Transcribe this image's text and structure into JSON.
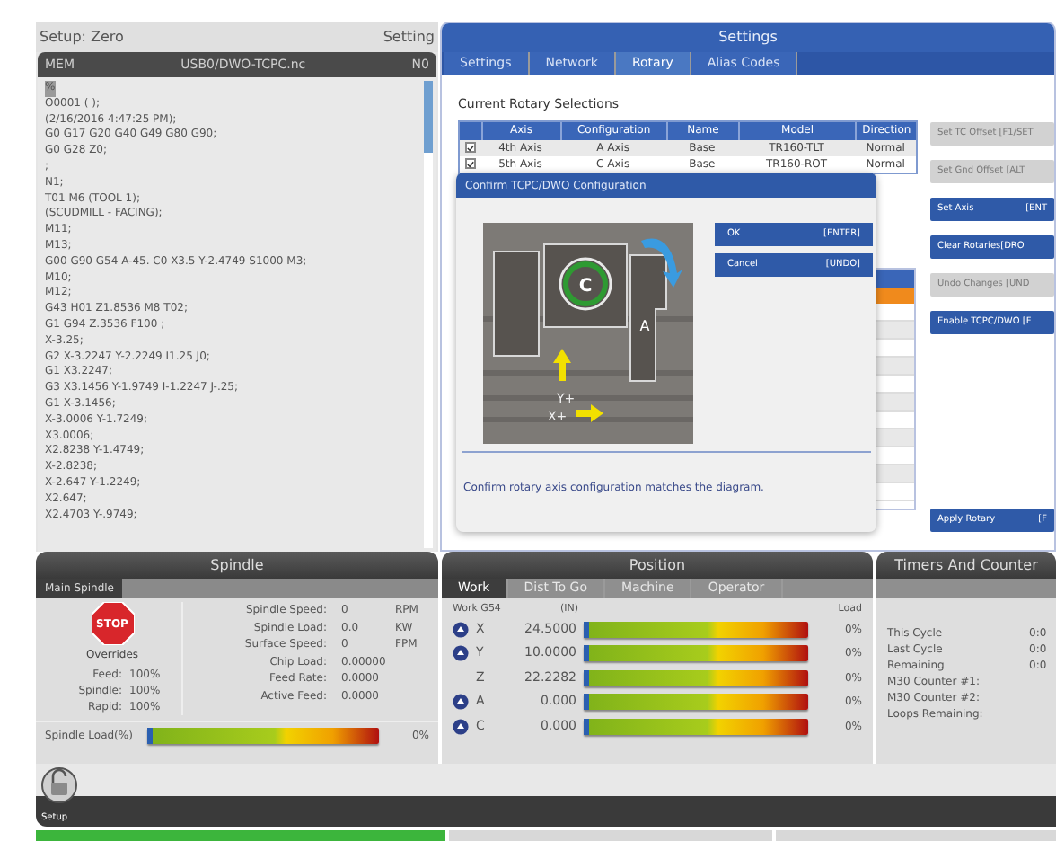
{
  "setup_header": {
    "title": "Setup: Zero",
    "mode": "Setting"
  },
  "program": {
    "device": "MEM",
    "file": "USB0/DWO-TCPC.nc",
    "line": "N0",
    "lines": [
      "%",
      "O0001 ( );",
      "(2/16/2016 4:47:25 PM);",
      "G0 G17 G20 G40 G49 G80 G90;",
      "G0 G28 Z0;",
      ";",
      "N1;",
      "T01 M6 (TOOL 1);",
      "(SCUDMILL - FACING);",
      "M11;",
      "M13;",
      "G00 G90 G54 A-45. C0 X3.5 Y-2.4749 S1000 M3;",
      "M10;",
      "M12;",
      "G43 H01 Z1.8536 M8 T02;",
      "G1 G94 Z.3536 F100 ;",
      "X-3.25;",
      "G2 X-3.2247 Y-2.2249 I1.25 J0;",
      "G1 X3.2247;",
      "G3 X3.1456 Y-1.9749 I-1.2247 J-.25;",
      "G1 X-3.1456;",
      "X-3.0006 Y-1.7249;",
      "X3.0006;",
      "X2.8238 Y-1.4749;",
      "X-2.8238;",
      "X-2.647 Y-1.2249;",
      "X2.647;",
      "X2.4703 Y-.9749;"
    ]
  },
  "settings": {
    "title": "Settings",
    "tabs": [
      {
        "label": "Settings",
        "selected": false
      },
      {
        "label": "Network",
        "selected": false
      },
      {
        "label": "Rotary",
        "selected": true
      },
      {
        "label": "Alias Codes",
        "selected": false
      }
    ],
    "section_title": "Current Rotary Selections",
    "table": {
      "columns": [
        "Axis",
        "Configuration",
        "Name",
        "Model",
        "Direction"
      ],
      "rows": [
        {
          "checked": true,
          "cells": [
            "4th Axis",
            "A Axis",
            "Base",
            "TR160-TLT",
            "Normal"
          ]
        },
        {
          "checked": true,
          "cells": [
            "5th Axis",
            "C Axis",
            "Base",
            "TR160-ROT",
            "Normal"
          ]
        }
      ]
    },
    "buttons": [
      {
        "label": "Set TC Offset [F1/SET",
        "disabled": true
      },
      {
        "label": "Set Gnd Offset [ALT",
        "disabled": true
      },
      {
        "label": "Set Axis",
        "key": "[ENT",
        "disabled": false
      },
      {
        "label": "Clear Rotaries[DRO",
        "disabled": false
      },
      {
        "label": "Undo Changes [UND",
        "disabled": true
      },
      {
        "label": "Enable TCPC/DWO [F",
        "disabled": false
      },
      {
        "label": "Apply Rotary",
        "key": "[F",
        "disabled": false
      }
    ]
  },
  "dialog": {
    "title": "Confirm TCPC/DWO Configuration",
    "diagram_labels": {
      "rotary": "C",
      "tilt": "A",
      "y_axis": "Y+",
      "x_axis": "X+"
    },
    "buttons": [
      {
        "label": "OK",
        "key": "[ENTER]"
      },
      {
        "label": "Cancel",
        "key": "[UNDO]"
      }
    ],
    "message": "Confirm rotary axis configuration matches the diagram."
  },
  "spindle": {
    "title": "Spindle",
    "tab": "Main Spindle",
    "overrides_title": "Overrides",
    "stop": "STOP",
    "overrides": [
      {
        "label": "Feed:",
        "value": "100%"
      },
      {
        "label": "Spindle:",
        "value": "100%"
      },
      {
        "label": "Rapid:",
        "value": "100%"
      }
    ],
    "readings": [
      {
        "label": "Spindle Speed:",
        "value": "0",
        "unit": "RPM"
      },
      {
        "label": "Spindle Load:",
        "value": "0.0",
        "unit": "KW"
      },
      {
        "label": "Surface Speed:",
        "value": "0",
        "unit": "FPM"
      },
      {
        "label": "Chip Load:",
        "value": "0.00000"
      },
      {
        "label": "Feed Rate:",
        "value": "0.0000"
      },
      {
        "label": "Active Feed:",
        "value": "0.0000"
      }
    ],
    "load": {
      "label": "Spindle Load(%)",
      "level": 0,
      "reading": "0%"
    }
  },
  "position": {
    "title": "Position",
    "tabs": [
      {
        "label": "Work",
        "selected": true
      },
      {
        "label": "Dist To Go",
        "selected": false
      },
      {
        "label": "Machine",
        "selected": false
      },
      {
        "label": "Operator",
        "selected": false
      }
    ],
    "header": {
      "coords": "Work G54",
      "units": "(IN)",
      "load": "Load"
    },
    "axes": [
      {
        "axis": "X",
        "value": "24.5000",
        "level": 0,
        "reading": "0%",
        "icon": true
      },
      {
        "axis": "Y",
        "value": "10.0000",
        "level": 0,
        "reading": "0%",
        "icon": true
      },
      {
        "axis": "Z",
        "value": "22.2282",
        "level": 0,
        "reading": "0%",
        "icon": false
      },
      {
        "axis": "A",
        "value": "0.000",
        "level": 0,
        "reading": "0%",
        "icon": true
      },
      {
        "axis": "C",
        "value": "0.000",
        "level": 0,
        "reading": "0%",
        "icon": true
      }
    ]
  },
  "timers": {
    "title": "Timers And Counter",
    "rows": [
      {
        "label": "This Cycle",
        "value": "0:0"
      },
      {
        "label": "Last Cycle",
        "value": "0:0"
      },
      {
        "label": "Remaining",
        "value": "0:0"
      },
      {
        "label": "M30 Counter #1:"
      },
      {
        "label": "M30 Counter #2:"
      },
      {
        "label": "Loops Remaining:"
      }
    ]
  },
  "bottom": {
    "setup_label": "Setup"
  }
}
